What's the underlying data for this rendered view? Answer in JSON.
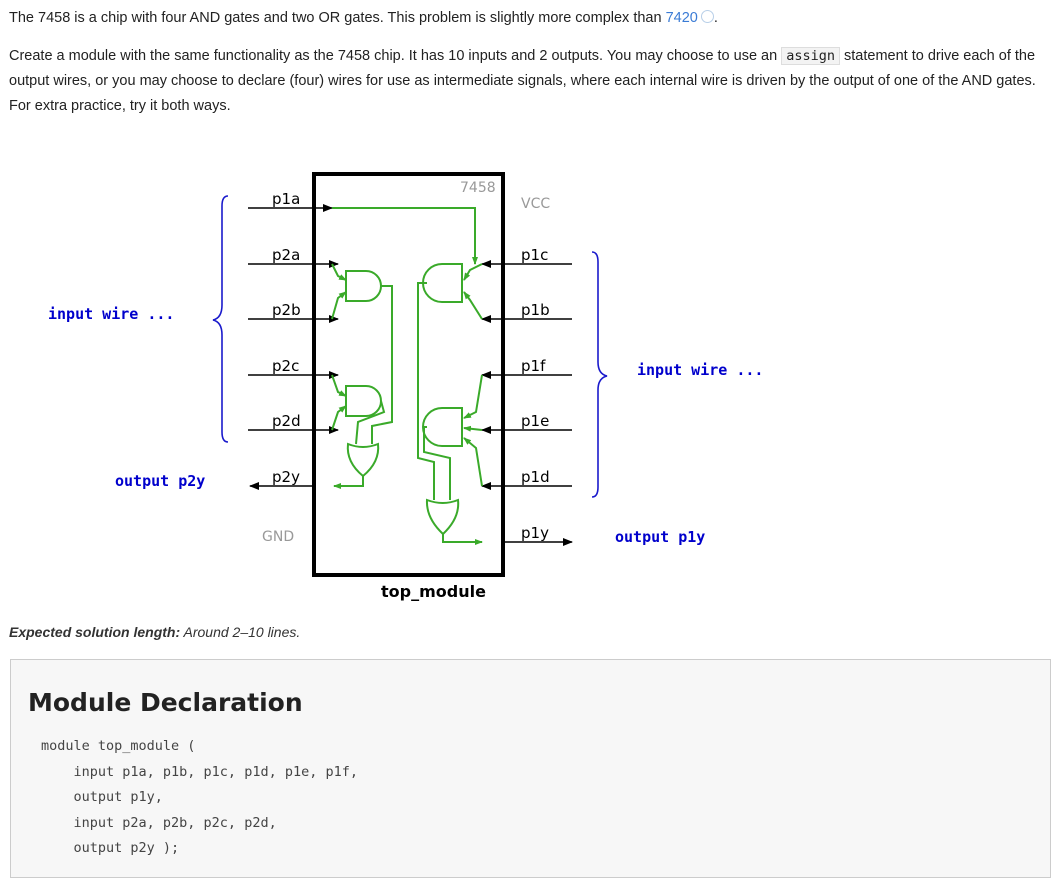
{
  "intro": {
    "p1_text": "The 7458 is a chip with four AND gates and two OR gates. This problem is slightly more complex than ",
    "p1_link": "7420",
    "p1_end": ".",
    "p2_before": "Create a module with the same functionality as the 7458 chip. It has 10 inputs and 2 outputs. You may choose to use an ",
    "p2_code": "assign",
    "p2_after": " statement to drive each of the output wires, or you may choose to declare (four) wires for use as intermediate signals, where each internal wire is driven by the output of one of the AND gates. For extra practice, try it both ways."
  },
  "diagram": {
    "chip_label": "7458",
    "module_label": "top_module",
    "vcc": "VCC",
    "gnd": "GND",
    "left_pins": [
      "p1a",
      "p2a",
      "p2b",
      "p2c",
      "p2d",
      "p2y"
    ],
    "right_pins": [
      "p1c",
      "p1b",
      "p1f",
      "p1e",
      "p1d",
      "p1y"
    ],
    "left_input_label": "input wire ...",
    "right_input_label": "input wire ...",
    "left_output_label": "output p2y",
    "right_output_label": "output p1y",
    "colors": {
      "wire": "#3aaa2a",
      "brace": "#1a1acc",
      "keyword": "#0000cc"
    }
  },
  "expected": {
    "label": "Expected solution length:",
    "value": " Around 2–10 lines."
  },
  "declaration": {
    "title": "Module Declaration",
    "code": "module top_module ( \n    input p1a, p1b, p1c, p1d, p1e, p1f,\n    output p1y,\n    input p2a, p2b, p2c, p2d,\n    output p2y );"
  }
}
